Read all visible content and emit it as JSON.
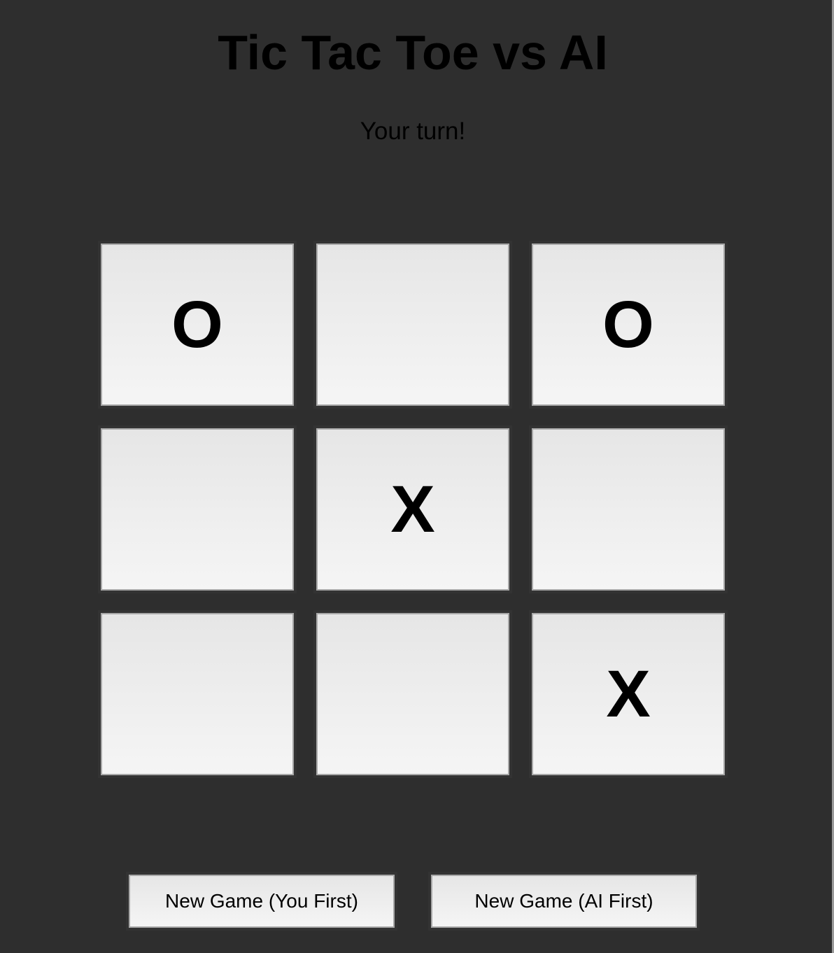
{
  "title": "Tic Tac Toe vs AI",
  "status": "Your turn!",
  "board": {
    "cells": [
      "O",
      "",
      "O",
      "",
      "X",
      "",
      "",
      "",
      "X"
    ]
  },
  "buttons": {
    "new_game_you_first": "New Game (You First)",
    "new_game_ai_first": "New Game (AI First)"
  }
}
